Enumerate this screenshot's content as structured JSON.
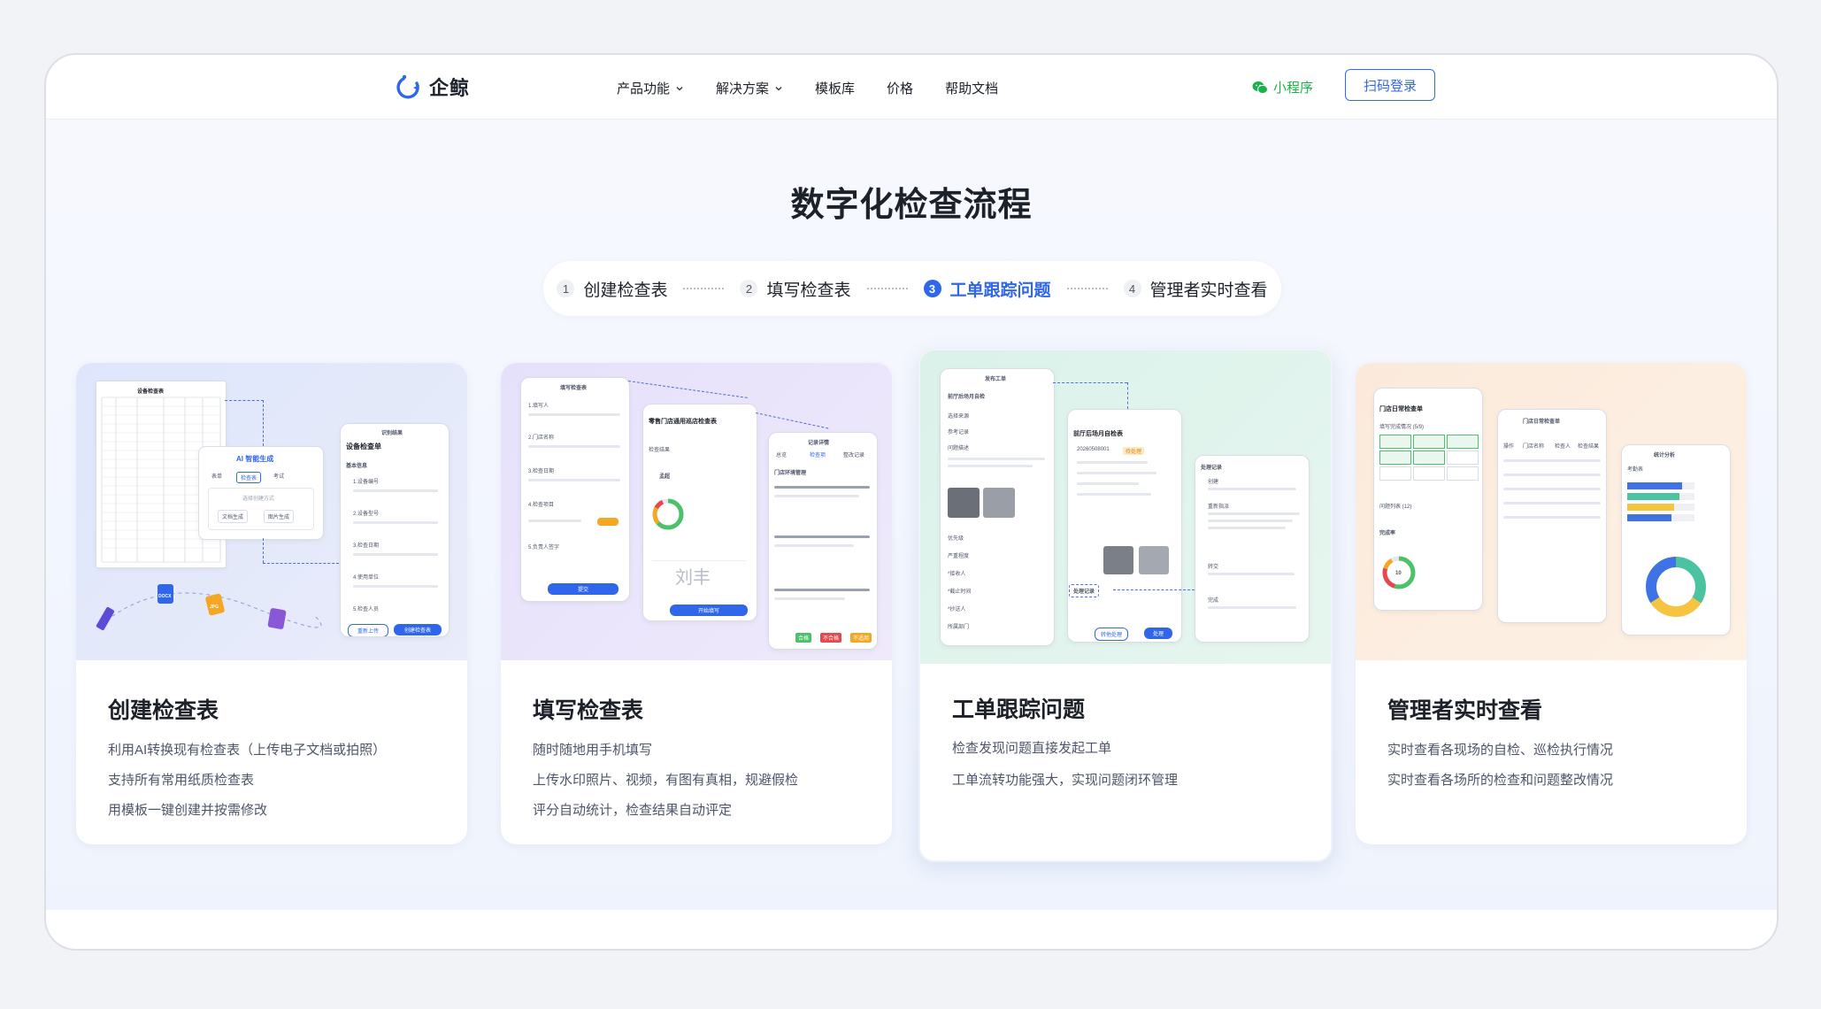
{
  "brand": {
    "name": "企鲸",
    "color": "#2f66ea"
  },
  "nav": {
    "items": [
      {
        "label": "产品功能",
        "has_dropdown": true
      },
      {
        "label": "解决方案",
        "has_dropdown": true
      },
      {
        "label": "模板库",
        "has_dropdown": false
      },
      {
        "label": "价格",
        "has_dropdown": false
      },
      {
        "label": "帮助文档",
        "has_dropdown": false
      }
    ],
    "mini_program": "小程序",
    "login": "扫码登录"
  },
  "section": {
    "title": "数字化检查流程"
  },
  "steps": [
    {
      "num": "1",
      "label": "创建检查表",
      "active": false
    },
    {
      "num": "2",
      "label": "填写检查表",
      "active": false
    },
    {
      "num": "3",
      "label": "工单跟踪问题",
      "active": true
    },
    {
      "num": "4",
      "label": "管理者实时查看",
      "active": false
    }
  ],
  "cards": [
    {
      "title": "创建检查表",
      "lines": [
        "利用AI转换现有检查表（上传电子文档或拍照）",
        "支持所有常用纸质检查表",
        "用模板一键创建并按需修改"
      ],
      "illu": {
        "ai_title": "AI 智能生成",
        "ai_tabs": [
          "表单",
          "检查表",
          "考试"
        ],
        "ai_hint": "选择创建方式",
        "ai_buttons": [
          "文档生成",
          "图片生成"
        ],
        "phone_header": "识别结果",
        "phone_title": "设备检查单",
        "phone_section": "基本信息",
        "fields": [
          "1.设备编号",
          "2.设备型号",
          "3.检查日期",
          "4.使用单位",
          "5.检查人员"
        ],
        "buttons": [
          "重新上传",
          "创建检查表"
        ],
        "paper_title": "设备检查表",
        "file_tags": [
          "DOCX",
          "JPG"
        ]
      }
    },
    {
      "title": "填写检查表",
      "lines": [
        "随时随地用手机填写",
        "上传水印照片、视频，有图有真相，规避假检",
        "评分自动统计，检查结果自动评定"
      ],
      "illu": {
        "p1_title": "填写检查表",
        "p1_fields": [
          "1.填写人",
          "2.门店名称",
          "3.检查日期",
          "4.检查项目",
          "5.负责人签字"
        ],
        "p1_button": "提交",
        "p2_title": "零售门店通用巡店检查表",
        "p2_score_label": "检查结果",
        "p2_person": "孟超",
        "p2_signature": "刘丰",
        "p2_button": "开始填写",
        "p3_header": "记录详情",
        "p3_tabs": [
          "总览",
          "检查项",
          "整改记录"
        ],
        "p3_item": "门店环境管理",
        "p3_badges": [
          "合格",
          "不合格",
          "不适用"
        ]
      }
    },
    {
      "title": "工单跟踪问题",
      "lines": [
        "检查发现问题直接发起工单",
        "工单流转功能强大，实现问题闭环管理"
      ],
      "illu": {
        "p1_header": "发布工单",
        "p1_title": "前厅后场月自检",
        "p1_fields": [
          "选择来源",
          "参考记录",
          "问题描述",
          "优先级",
          "严重程度",
          "*接收人",
          "*截止时间",
          "*抄送人",
          "所属部门"
        ],
        "p2_title": "前厅后场月自检表",
        "p2_number": "20260508001",
        "p2_badge": "待处理",
        "p2_buttons": [
          "转他处理",
          "处理"
        ],
        "p3_title": "处理记录",
        "p3_items": [
          "创建",
          "重新指派",
          "转交",
          "完成"
        ],
        "float_label": "处理记录"
      }
    },
    {
      "title": "管理者实时查看",
      "lines": [
        "实时查看各现场的自检、巡检执行情况",
        "实时查看各场所的检查和问题整改情况"
      ],
      "illu": {
        "p1_title": "门店日常检查单",
        "p1_subtitle": "填写完成情况 (5/9)",
        "p1_sub2": "问题列表 (12)",
        "p1_sub3": "完成率",
        "p1_ring_value": "10",
        "p2_title": "门店日常检查单",
        "p2_cols": [
          "操作",
          "门店名称",
          "检查人",
          "检查结果"
        ],
        "p3_title": "统计分析",
        "p3_sub": "考勤表",
        "bar_levels": [
          0.82,
          0.78,
          0.7,
          0.66
        ],
        "donut_colors": [
          "#4bc2a0",
          "#f5c542",
          "#3f72e4"
        ]
      }
    }
  ],
  "colors": {
    "accent": "#2f66ea",
    "green": "#1ab34a",
    "warn": "#f5a623",
    "danger": "#e5484d"
  }
}
